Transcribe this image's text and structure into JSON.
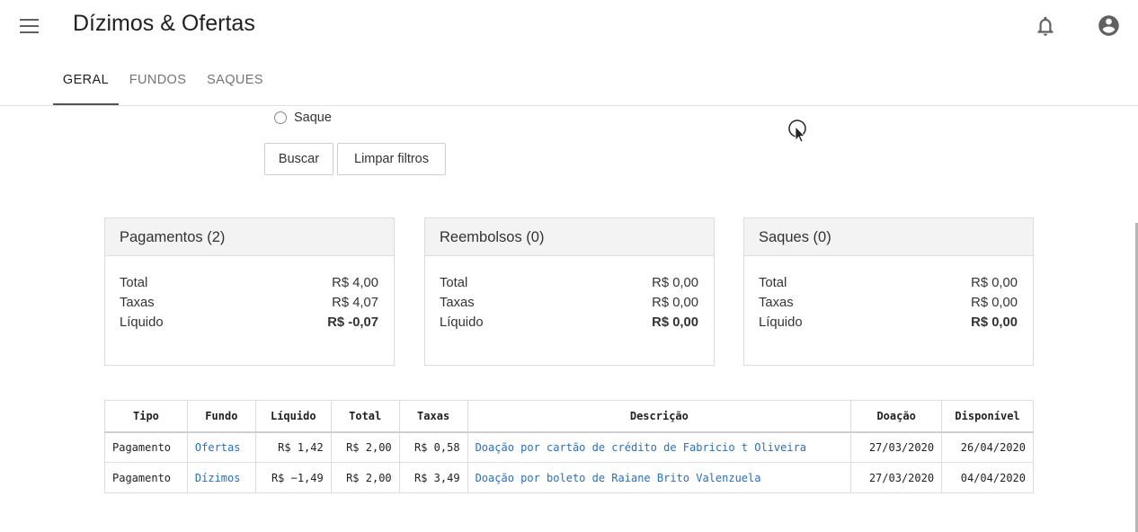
{
  "app": {
    "title": "Dízimos & Ofertas"
  },
  "tabs": [
    {
      "label": "GERAL",
      "active": true
    },
    {
      "label": "FUNDOS",
      "active": false
    },
    {
      "label": "SAQUES",
      "active": false
    }
  ],
  "filters": {
    "radio_label": "Saque",
    "search_label": "Buscar",
    "clear_label": "Limpar filtros"
  },
  "cards": [
    {
      "title": "Pagamentos (2)",
      "total_label": "Total",
      "total": "R$ 4,00",
      "fees_label": "Taxas",
      "fees": "R$ 4,07",
      "net_label": "Líquido",
      "net": "R$ -0,07"
    },
    {
      "title": "Reembolsos (0)",
      "total_label": "Total",
      "total": "R$ 0,00",
      "fees_label": "Taxas",
      "fees": "R$ 0,00",
      "net_label": "Líquido",
      "net": "R$ 0,00"
    },
    {
      "title": "Saques (0)",
      "total_label": "Total",
      "total": "R$ 0,00",
      "fees_label": "Taxas",
      "fees": "R$ 0,00",
      "net_label": "Líquido",
      "net": "R$ 0,00"
    }
  ],
  "table": {
    "headers": [
      "Tipo",
      "Fundo",
      "Líquido",
      "Total",
      "Taxas",
      "Descrição",
      "Doação",
      "Disponível"
    ],
    "rows": [
      [
        "Pagamento",
        "Ofertas",
        "R$ 1,42",
        "R$ 2,00",
        "R$ 0,58",
        "Doação por cartão de crédito de Fabricio t Oliveira",
        "27/03/2020",
        "26/04/2020"
      ],
      [
        "Pagamento",
        "Dízimos",
        "R$ −1,49",
        "R$ 2,00",
        "R$ 3,49",
        "Doação por boleto de Raiane Brito Valenzuela",
        "27/03/2020",
        "04/04/2020"
      ]
    ]
  },
  "colors": {
    "link": "#2a6ebc",
    "card_header_bg": "#f3f3f3",
    "icon": "#616161"
  },
  "icons": {
    "menu": "menu-icon",
    "notifications": "bell-icon",
    "account": "account-circle-icon"
  }
}
